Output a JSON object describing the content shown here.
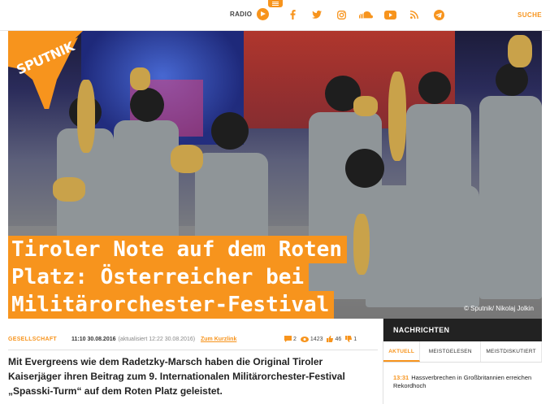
{
  "header": {
    "radio_label": "RADIO",
    "search_label": "SUCHE",
    "social_icons": [
      "facebook-icon",
      "twitter-icon",
      "instagram-icon",
      "soundcloud-icon",
      "youtube-icon",
      "rss-icon",
      "telegram-icon"
    ]
  },
  "brand": {
    "logo_text": "SPUTNIK",
    "accent_color": "#f7941d"
  },
  "article": {
    "headline_lines": [
      "Tiroler Note auf dem Roten",
      "Platz: Österreicher bei",
      "Militärorchester-Festival"
    ],
    "photo_credit": "© Sputnik/ Nikolaj Jolkin",
    "category": "GESELLSCHAFT",
    "published": "11:10 30.08.2016",
    "updated": "(aktualisiert 12:22 30.08.2016)",
    "short_link": "Zum Kurzlink",
    "stats": {
      "comments": "2",
      "views": "1423",
      "likes": "46",
      "dislikes": "1"
    },
    "lead": "Mit Evergreens wie dem Radetzky-Marsch haben die Original Tiroler Kaiserjäger ihren Beitrag zum 9. Internationalen Militärorchester-Festival „Spasski-Turm“ auf dem Roten Platz geleistet."
  },
  "sidebar": {
    "title": "NACHRICHTEN",
    "tabs": [
      "AKTUELL",
      "MEISTGELESEN",
      "MEISTDISKUTIERT"
    ],
    "news": [
      {
        "time": "13:31",
        "text": "Hassverbrechen in Großbritannien erreichen Rekordhoch"
      }
    ]
  }
}
